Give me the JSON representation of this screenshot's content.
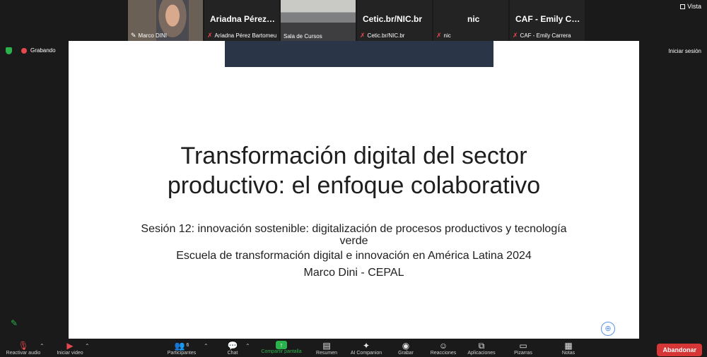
{
  "participants": [
    {
      "label": "Marco DINI",
      "type": "video"
    },
    {
      "title": "Ariadna Pérez B...",
      "label": "Ariadna Pérez Bartomeu",
      "muted": true
    },
    {
      "label": "Sala de Cursos",
      "type": "video"
    },
    {
      "title": "Cetic.br/NIC.br",
      "label": "Cetic.br/NIC.br",
      "muted": true
    },
    {
      "title": "nic",
      "label": "nic",
      "muted": true
    },
    {
      "title": "CAF - Emily Carr...",
      "label": "CAF - Emily Carrera",
      "muted": true
    }
  ],
  "header": {
    "view_label": "Vista",
    "recording_label": "Grabando",
    "signin_label": "Iniciar sesión"
  },
  "slide": {
    "title_line1": "Transformación digital del sector",
    "title_line2": "productivo: el enfoque colaborativo",
    "subtitle": "Sesión 12: innovación sostenible: digitalización de procesos productivos y tecnología verde",
    "school": "Escuela de transformación digital e innovación en América Latina 2024",
    "author": "Marco Dini - CEPAL"
  },
  "toolbar": {
    "audio": "Reactivar audio",
    "video": "Iniciar video",
    "participants": "Participantes",
    "participants_count": "6",
    "chat": "Chat",
    "share": "Compartir pantalla",
    "summary": "Resumen",
    "ai": "AI Companion",
    "record": "Grabar",
    "reactions": "Reacciones",
    "apps": "Aplicaciones",
    "whiteboards": "Pizarras",
    "notes": "Notas",
    "leave": "Abandonar"
  },
  "colors": {
    "accent_green": "#2bb24c",
    "leave_red": "#d63636",
    "muted_red": "#e5484d",
    "slide_header": "#2a3548"
  }
}
